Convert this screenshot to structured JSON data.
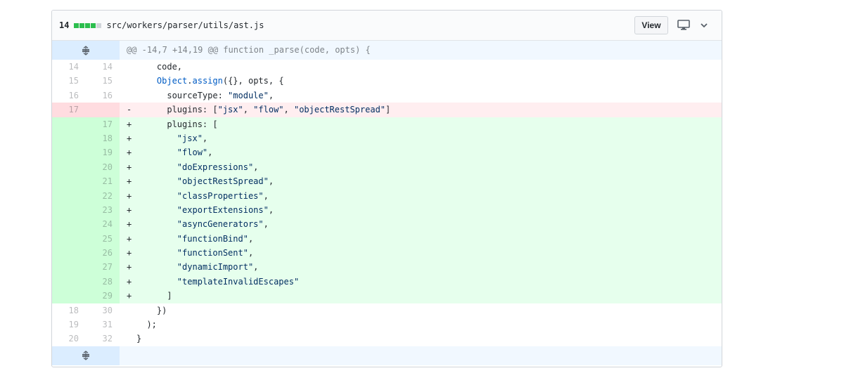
{
  "file": {
    "change_count": "14",
    "path": "src/workers/parser/utils/ast.js",
    "view_label": "View",
    "diffstat_colors": [
      "#2cbe4e",
      "#2cbe4e",
      "#2cbe4e",
      "#2cbe4e",
      "#d1d5da"
    ]
  },
  "icons": {
    "expand": "unfold-icon",
    "display": "desktop-icon",
    "menu": "chevron-down-icon"
  },
  "hunk_header": "@@ -14,7 +14,19 @@ function _parse(code, opts) {",
  "lines": [
    {
      "type": "ctx",
      "old": "14",
      "new": "14",
      "marker": " ",
      "text": "    code,"
    },
    {
      "type": "ctx",
      "old": "15",
      "new": "15",
      "marker": " ",
      "text": "    Object.assign({}, opts, {"
    },
    {
      "type": "ctx",
      "old": "16",
      "new": "16",
      "marker": " ",
      "text": "      sourceType: \"module\","
    },
    {
      "type": "del",
      "old": "17",
      "new": "",
      "marker": "-",
      "text": "      plugins: [\"jsx\", \"flow\", \"objectRestSpread\"]"
    },
    {
      "type": "add",
      "old": "",
      "new": "17",
      "marker": "+",
      "text": "      plugins: ["
    },
    {
      "type": "add",
      "old": "",
      "new": "18",
      "marker": "+",
      "text": "        \"jsx\","
    },
    {
      "type": "add",
      "old": "",
      "new": "19",
      "marker": "+",
      "text": "        \"flow\","
    },
    {
      "type": "add",
      "old": "",
      "new": "20",
      "marker": "+",
      "text": "        \"doExpressions\","
    },
    {
      "type": "add",
      "old": "",
      "new": "21",
      "marker": "+",
      "text": "        \"objectRestSpread\","
    },
    {
      "type": "add",
      "old": "",
      "new": "22",
      "marker": "+",
      "text": "        \"classProperties\","
    },
    {
      "type": "add",
      "old": "",
      "new": "23",
      "marker": "+",
      "text": "        \"exportExtensions\","
    },
    {
      "type": "add",
      "old": "",
      "new": "24",
      "marker": "+",
      "text": "        \"asyncGenerators\","
    },
    {
      "type": "add",
      "old": "",
      "new": "25",
      "marker": "+",
      "text": "        \"functionBind\","
    },
    {
      "type": "add",
      "old": "",
      "new": "26",
      "marker": "+",
      "text": "        \"functionSent\","
    },
    {
      "type": "add",
      "old": "",
      "new": "27",
      "marker": "+",
      "text": "        \"dynamicImport\","
    },
    {
      "type": "add",
      "old": "",
      "new": "28",
      "marker": "+",
      "text": "        \"templateInvalidEscapes\""
    },
    {
      "type": "add",
      "old": "",
      "new": "29",
      "marker": "+",
      "text": "      ]"
    },
    {
      "type": "ctx",
      "old": "18",
      "new": "30",
      "marker": " ",
      "text": "    })"
    },
    {
      "type": "ctx",
      "old": "19",
      "new": "31",
      "marker": " ",
      "text": "  );"
    },
    {
      "type": "ctx",
      "old": "20",
      "new": "32",
      "marker": " ",
      "text": "}"
    }
  ]
}
